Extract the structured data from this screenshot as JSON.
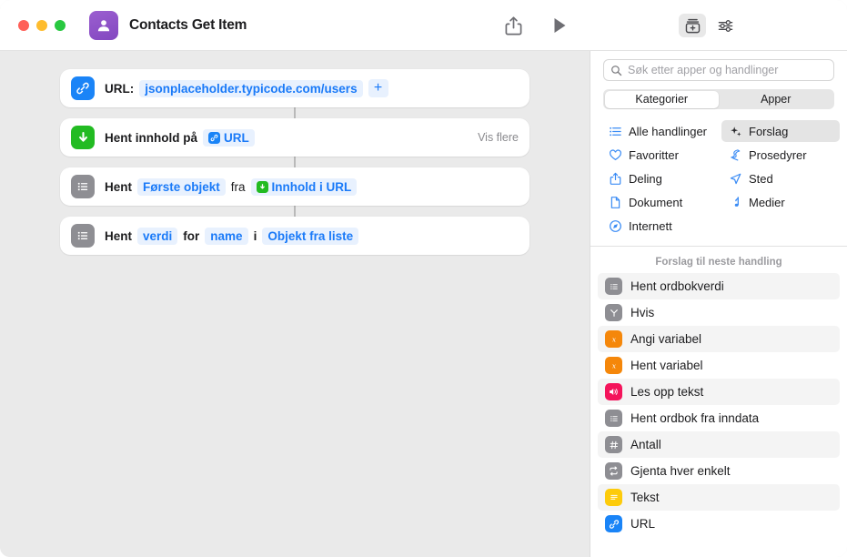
{
  "window": {
    "title": "Contacts Get Item",
    "app_icon": "contacts-icon",
    "traffic_lights": [
      "close",
      "minimize",
      "zoom"
    ]
  },
  "toolbar": {
    "share_label": "share-icon",
    "run_label": "play-icon",
    "library_label": "action-library-icon",
    "settings_label": "sliders-icon"
  },
  "workflow": {
    "actions": [
      {
        "icon": "link-icon",
        "icon_color": "#1a84f7",
        "label": "URL:",
        "value": "jsonplaceholder.typicode.com/users",
        "add": "+",
        "trailing": ""
      },
      {
        "icon": "download-arrow-icon",
        "icon_color": "#22bb22",
        "label": "Hent innhold på",
        "token": "URL",
        "trailing": "Vis flere"
      },
      {
        "icon": "list-icon",
        "icon_color": "#8e8e93",
        "label": "Hent",
        "token1": "Første objekt",
        "mid": "fra",
        "token2": "Innhold i URL"
      },
      {
        "icon": "list-icon",
        "icon_color": "#8e8e93",
        "label": "Hent",
        "token1": "verdi",
        "mid1": "for",
        "token2": "name",
        "mid2": "i",
        "token3": "Objekt fra liste"
      }
    ]
  },
  "sidebar": {
    "search": {
      "placeholder": "Søk etter apper og handlinger",
      "value": "",
      "icon": "search-icon"
    },
    "segmented": {
      "options": [
        "Kategorier",
        "Apper"
      ],
      "selected": "Kategorier"
    },
    "categories": [
      {
        "label": "Alle handlinger",
        "icon": "list-bullet-icon",
        "selected": false
      },
      {
        "label": "Forslag",
        "icon": "sparkles-icon",
        "selected": true
      },
      {
        "label": "Favoritter",
        "icon": "heart-icon",
        "selected": false
      },
      {
        "label": "Prosedyrer",
        "icon": "scripting-icon",
        "selected": false
      },
      {
        "label": "Deling",
        "icon": "share-icon",
        "selected": false
      },
      {
        "label": "Sted",
        "icon": "location-arrow-icon",
        "selected": false
      },
      {
        "label": "Dokument",
        "icon": "document-icon",
        "selected": false
      },
      {
        "label": "Medier",
        "icon": "music-note-icon",
        "selected": false
      },
      {
        "label": "Internett",
        "icon": "safari-compass-icon",
        "selected": false
      }
    ],
    "suggestions_header": "Forslag til neste handling",
    "suggestions": [
      {
        "label": "Hent ordbokverdi",
        "icon": "list-icon",
        "color": "gray"
      },
      {
        "label": "Hvis",
        "icon": "branch-icon",
        "color": "gray"
      },
      {
        "label": "Angi variabel",
        "icon": "variable-icon",
        "color": "orange"
      },
      {
        "label": "Hent variabel",
        "icon": "variable-icon",
        "color": "orange"
      },
      {
        "label": "Les opp tekst",
        "icon": "speaker-icon",
        "color": "pink"
      },
      {
        "label": "Hent ordbok fra inndata",
        "icon": "list-icon",
        "color": "gray"
      },
      {
        "label": "Antall",
        "icon": "hash-icon",
        "color": "gray"
      },
      {
        "label": "Gjenta hver enkelt",
        "icon": "repeat-icon",
        "color": "gray"
      },
      {
        "label": "Tekst",
        "icon": "text-icon",
        "color": "yellow"
      },
      {
        "label": "URL",
        "icon": "link-icon",
        "color": "blue"
      }
    ]
  },
  "colors": {
    "accent": "#1a7af8",
    "canvas": "#eaeaea",
    "token_bg": "#e8f1fe"
  }
}
